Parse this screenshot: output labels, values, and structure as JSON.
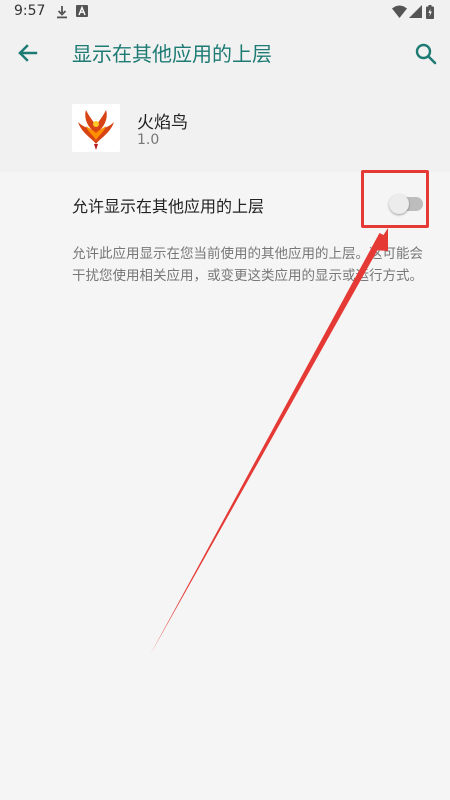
{
  "status_bar": {
    "time": "9:57",
    "icons": [
      "download-icon",
      "a-icon",
      "wifi-icon",
      "signal-icon",
      "battery-icon"
    ]
  },
  "app_bar": {
    "title": "显示在其他应用的上层",
    "back_icon": "arrow-back-icon",
    "search_icon": "search-icon"
  },
  "app": {
    "name": "火焰鸟",
    "version": "1.0",
    "icon": "phoenix-icon"
  },
  "setting": {
    "label": "允许显示在其他应用的上层",
    "enabled": false,
    "description": "允许此应用显示在您当前使用的其他应用的上层。这可能会干扰您使用相关应用，或变更这类应用的显示或运行方式。"
  },
  "colors": {
    "accent": "#1e7b74",
    "annotation": "#e53935",
    "background": "#f5f5f5"
  }
}
